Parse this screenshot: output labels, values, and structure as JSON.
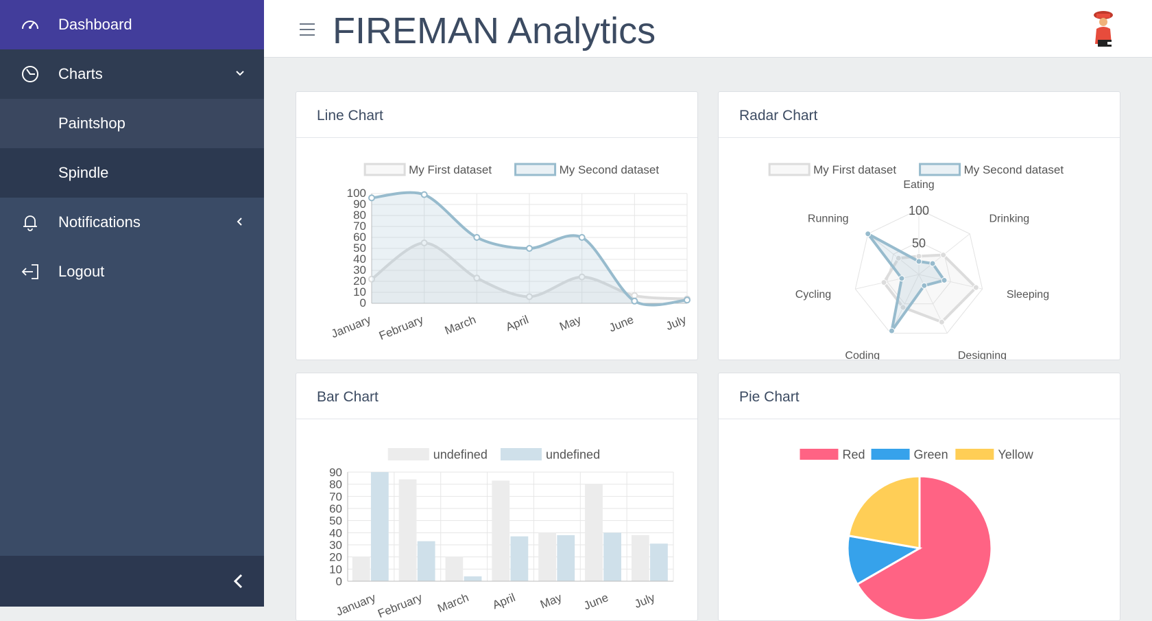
{
  "sidebar": {
    "items": [
      {
        "label": "Dashboard",
        "icon": "speedometer-icon"
      },
      {
        "label": "Charts",
        "icon": "pie-chart-icon"
      },
      {
        "label": "Paintshop"
      },
      {
        "label": "Spindle"
      },
      {
        "label": "Notifications",
        "icon": "bell-icon"
      },
      {
        "label": "Logout",
        "icon": "logout-icon"
      }
    ]
  },
  "header": {
    "title": "FIREMAN Analytics",
    "avatar_icon": "fireman-avatar-icon"
  },
  "cards": {
    "line": {
      "title": "Line Chart"
    },
    "radar": {
      "title": "Radar Chart"
    },
    "bar": {
      "title": "Bar Chart"
    },
    "pie": {
      "title": "Pie Chart"
    }
  },
  "chart_data": [
    {
      "type": "line",
      "categories": [
        "January",
        "February",
        "March",
        "April",
        "May",
        "June",
        "July"
      ],
      "series": [
        {
          "name": "My First dataset",
          "values": [
            22,
            55,
            23,
            6,
            24,
            7,
            4
          ],
          "color": "#dcdcdc"
        },
        {
          "name": "My Second dataset",
          "values": [
            96,
            99,
            60,
            50,
            60,
            2,
            3
          ],
          "color": "#97bbcd"
        }
      ],
      "ylim": [
        0,
        100
      ],
      "yticks": [
        0,
        10,
        20,
        30,
        40,
        50,
        60,
        70,
        80,
        90,
        100
      ]
    },
    {
      "type": "radar",
      "labels": [
        "Eating",
        "Drinking",
        "Sleeping",
        "Designing",
        "Coding",
        "Cycling",
        "Running"
      ],
      "series": [
        {
          "name": "My First dataset",
          "values": [
            28,
            48,
            90,
            81,
            56,
            55,
            40
          ],
          "color": "#dcdcdc"
        },
        {
          "name": "My Second dataset",
          "values": [
            20,
            27,
            40,
            19,
            96,
            27,
            100
          ],
          "color": "#97bbcd"
        }
      ],
      "rlim": [
        0,
        100
      ],
      "rticks": [
        50,
        100
      ]
    },
    {
      "type": "bar",
      "categories": [
        "January",
        "February",
        "March",
        "April",
        "May",
        "June",
        "July"
      ],
      "series": [
        {
          "name": "undefined",
          "values": [
            20,
            84,
            20,
            83,
            40,
            80,
            38
          ],
          "color": "#ececec"
        },
        {
          "name": "undefined",
          "values": [
            90,
            33,
            4,
            37,
            38,
            40,
            31
          ],
          "color": "#cfe0ea"
        }
      ],
      "ylim": [
        0,
        90
      ],
      "yticks": [
        0,
        10,
        20,
        30,
        40,
        50,
        60,
        70,
        80,
        90
      ]
    },
    {
      "type": "pie",
      "series": [
        {
          "name": "Red",
          "value": 300,
          "color": "#ff6384"
        },
        {
          "name": "Green",
          "value": 50,
          "color": "#36a2eb"
        },
        {
          "name": "Yellow",
          "value": 100,
          "color": "#ffce56"
        }
      ]
    }
  ]
}
